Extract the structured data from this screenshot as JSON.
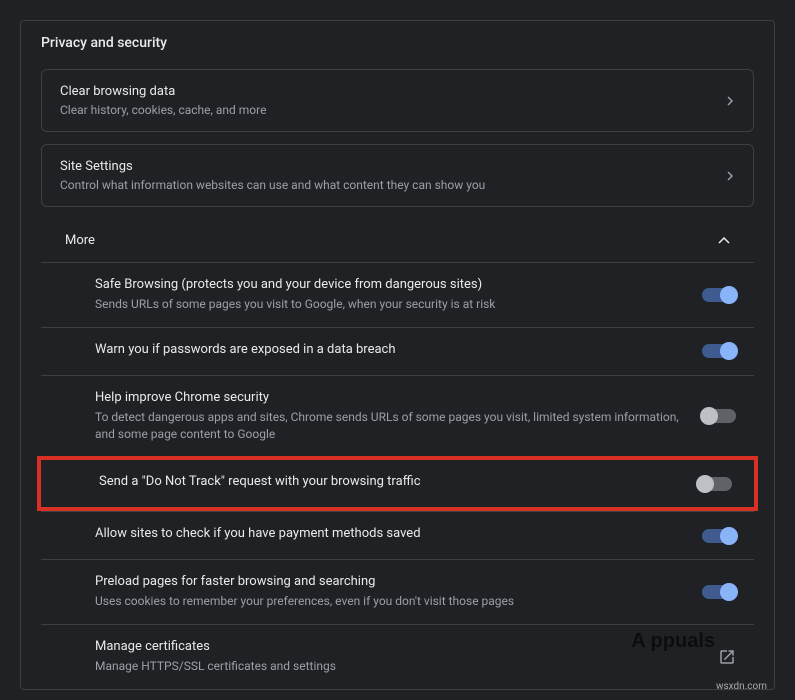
{
  "section_title": "Privacy and security",
  "cards": {
    "clear_data": {
      "title": "Clear browsing data",
      "sub": "Clear history, cookies, cache, and more"
    },
    "site_settings": {
      "title": "Site Settings",
      "sub": "Control what information websites can use and what content they can show you"
    }
  },
  "more_label": "More",
  "items": {
    "safe_browsing": {
      "title": "Safe Browsing (protects you and your device from dangerous sites)",
      "desc": "Sends URLs of some pages you visit to Google, when your security is at risk"
    },
    "passwords": {
      "title": "Warn you if passwords are exposed in a data breach"
    },
    "help_improve": {
      "title": "Help improve Chrome security",
      "desc": "To detect dangerous apps and sites, Chrome sends URLs of some pages you visit, limited system information, and some page content to Google"
    },
    "dnt": {
      "title": "Send a \"Do Not Track\" request with your browsing traffic"
    },
    "payment": {
      "title": "Allow sites to check if you have payment methods saved"
    },
    "preload": {
      "title": "Preload pages for faster browsing and searching",
      "desc": "Uses cookies to remember your preferences, even if you don't visit those pages"
    },
    "certs": {
      "title": "Manage certificates",
      "desc": "Manage HTTPS/SSL certificates and settings"
    }
  },
  "watermark": "A   ppuals",
  "footer": "wsxdn.com"
}
